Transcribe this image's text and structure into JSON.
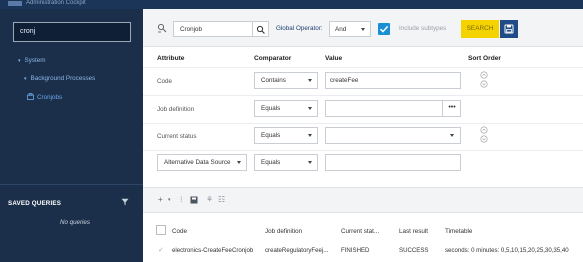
{
  "app": {
    "title": "Administration Cockpit"
  },
  "sidebar": {
    "search_value": "cronj",
    "items": [
      {
        "label": "System",
        "caret": "▾"
      },
      {
        "label": "Background Processes",
        "caret": "▾"
      },
      {
        "label": "Cronjobs",
        "icon": "cronjob-icon"
      }
    ],
    "saved_queries_title": "SAVED QUERIES",
    "no_queries_text": "No queries"
  },
  "toolbar": {
    "type_value": "Cronjob",
    "global_operator_label": "Global Operator:",
    "global_operator_value": "And",
    "include_subtypes_label": "Include subtypes",
    "include_subtypes_checked": true,
    "search_label": "SEARCH"
  },
  "criteria": {
    "headers": {
      "attribute": "Attribute",
      "comparator": "Comparator",
      "value": "Value",
      "sort_order": "Sort Order"
    },
    "rows": [
      {
        "attribute": "Code",
        "comparator": "Contains",
        "value": "createFee"
      },
      {
        "attribute": "Job definition",
        "comparator": "Equals",
        "value": "",
        "ellipsis": "•••"
      },
      {
        "attribute": "Current status",
        "comparator": "Equals",
        "value": ""
      },
      {
        "attribute": "Alternative Data Source",
        "comparator": "Equals",
        "value": ""
      }
    ]
  },
  "results": {
    "headers": [
      "Code",
      "Job definition",
      "Current stat...",
      "Last result",
      "Timetable"
    ],
    "rows": [
      [
        "electronics-CreateFeeCronjob",
        "createRegulatoryFeej...",
        "FINISHED",
        "SUCCESS",
        "seconds: 0 minutes: 0,5,10,15,20,25,30,35,40"
      ]
    ]
  },
  "colors": {
    "sidebar_bg": "#1b2f4a",
    "accent_blue": "#1b8fd6",
    "search_yellow": "#f5d300",
    "save_navy": "#1f4c86"
  }
}
